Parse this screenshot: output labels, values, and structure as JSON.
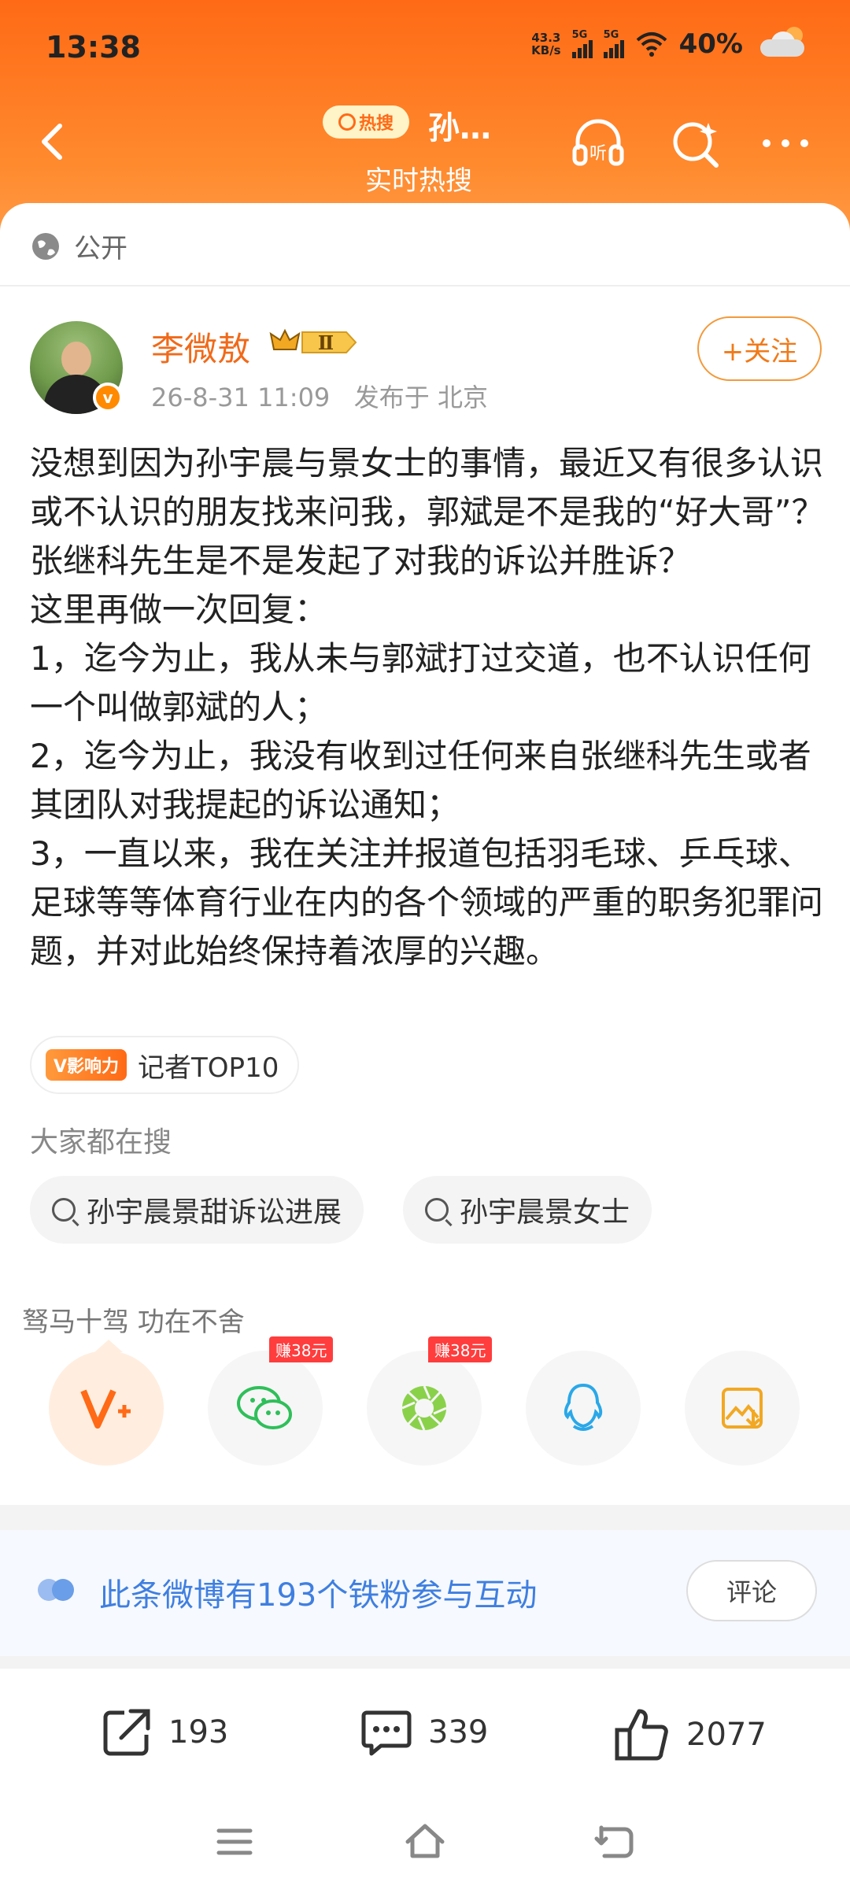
{
  "status_bar": {
    "time": "13:38",
    "speed_value": "43.3",
    "speed_unit": "KB/s",
    "signal1_label": "5G",
    "signal2_label": "5G",
    "battery": "40%"
  },
  "nav": {
    "hot_badge": "热搜",
    "title": "孙…",
    "subtitle": "实时热搜",
    "listen_icon": "headphones-listen-icon",
    "search_icon": "search-sparkle-icon",
    "more_icon": "more-icon"
  },
  "post": {
    "visibility": "公开",
    "author": "李微敖",
    "level": "Ⅱ",
    "verified": "v",
    "date": "26-8-31 11:09",
    "location": "发布于 北京",
    "follow_label": "+关注",
    "paragraphs": [
      "没想到因为孙宇晨与景女士的事情，最近又有很多认识或不认识的朋友找来问我，郭斌是不是我的“好大哥”？张继科先生是不是发起了对我的诉讼并胜诉？",
      "这里再做一次回复：",
      "1，迄今为止，我从未与郭斌打过交道，也不认识任何一个叫做郭斌的人；",
      "2，迄今为止，我没有收到过任何来自张继科先生或者其团队对我提起的诉讼通知；",
      "3，一直以来，我在关注并报道包括羽毛球、乒乓球、足球等等体育行业在内的各个领域的严重的职务犯罪问题，并对此始终保持着浓厚的兴趣。"
    ],
    "influence_badge": "V影响力",
    "influence_text": "记者TOP10"
  },
  "search": {
    "label": "大家都在搜",
    "chips": [
      "孙宇晨景甜诉讼进展",
      "孙宇晨景女士"
    ]
  },
  "share": {
    "slogan": "驽马十驾 功在不舍",
    "earn_label": "赚38元",
    "targets": [
      "v-plus-icon",
      "wechat-icon",
      "moments-icon",
      "qq-icon",
      "save-image-icon"
    ]
  },
  "fans": {
    "text": "此条微博有193个铁粉参与互动",
    "button": "评论"
  },
  "actions": {
    "reposts": "193",
    "comments": "339",
    "likes": "2077"
  },
  "colors": {
    "accent": "#ff6a16",
    "username": "#f06a1a",
    "fans_text": "#3f7fe0"
  }
}
